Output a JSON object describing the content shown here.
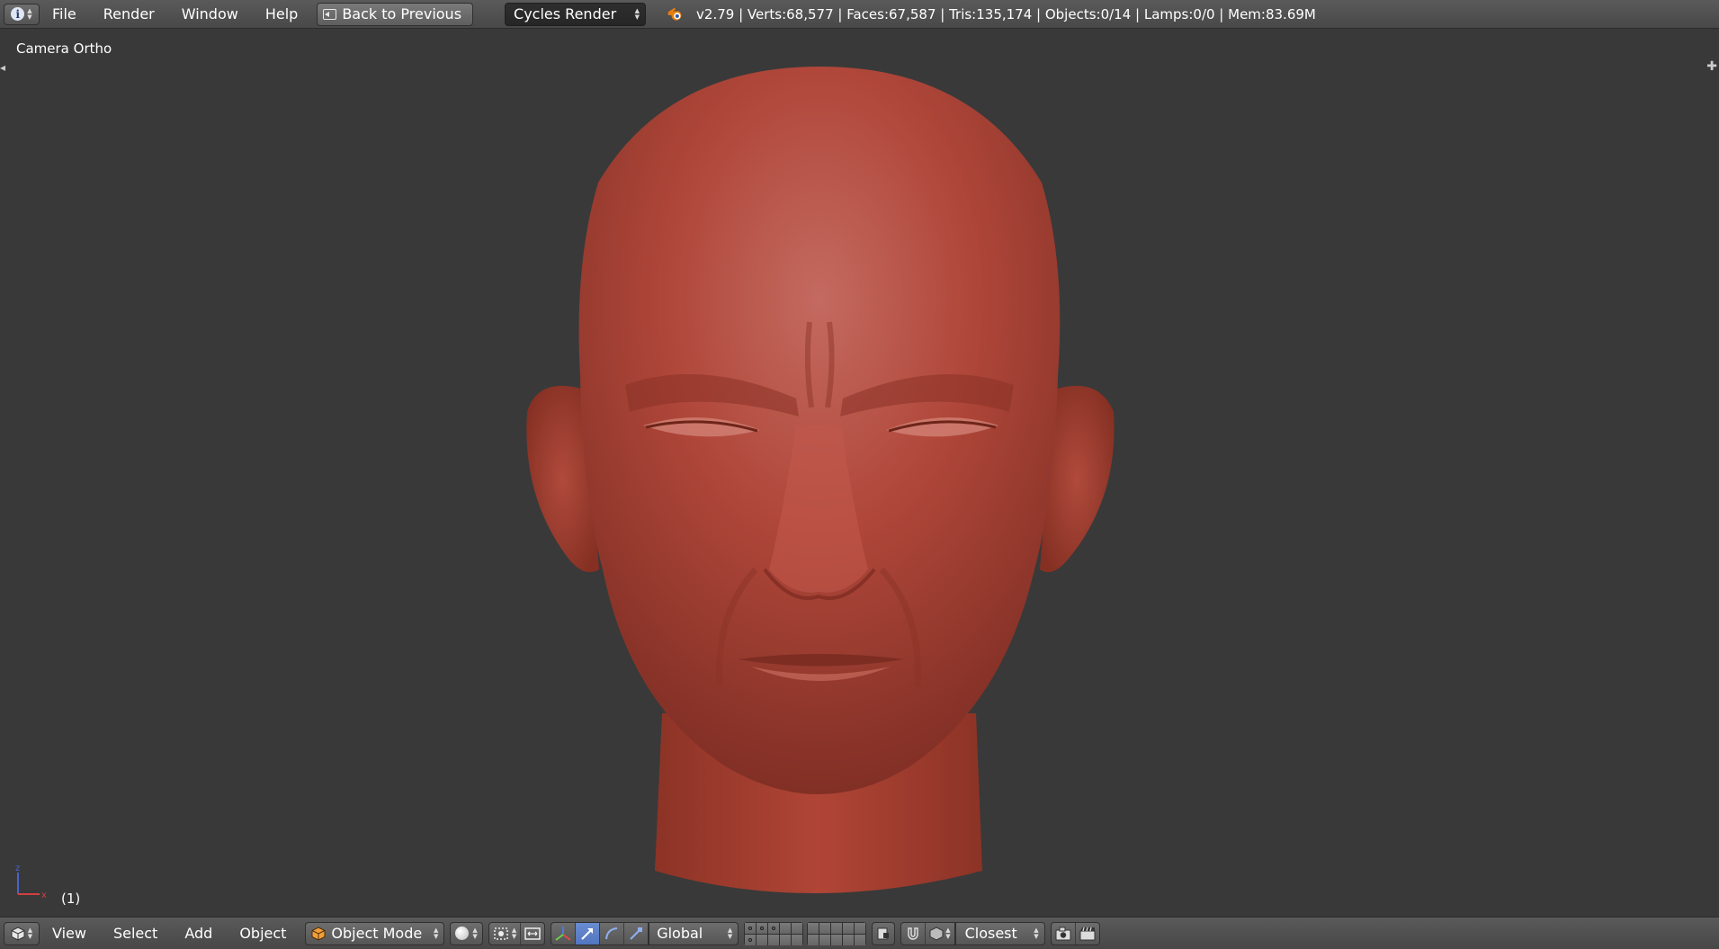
{
  "top_header": {
    "editor_type_icon": "info-icon",
    "menus": [
      "File",
      "Render",
      "Window",
      "Help"
    ],
    "back_button_label": "Back to Previous",
    "render_engine": "Cycles Render",
    "stats": "v2.79 | Verts:68,577 | Faces:67,587 | Tris:135,174 | Objects:0/14 | Lamps:0/0 | Mem:83.69M"
  },
  "viewport": {
    "view_name": "Camera Ortho",
    "frame_label": "(1)",
    "axis_labels": {
      "z": "z",
      "x": "x"
    },
    "model_color": "#b0473a",
    "background_color": "#393939"
  },
  "bottom_header": {
    "editor_type_icon": "3d-view-cube-icon",
    "menus": [
      "View",
      "Select",
      "Add",
      "Object"
    ],
    "mode": "Object Mode",
    "viewport_shading_icon": "solid-sphere-icon",
    "pivot_icon": "pivot-point-icon",
    "transform_orientation": "Global",
    "snap_target": "Closest"
  },
  "colors": {
    "header_bg": "#4f4f4f",
    "accent_active": "#5680c2",
    "text": "#ffffff"
  }
}
